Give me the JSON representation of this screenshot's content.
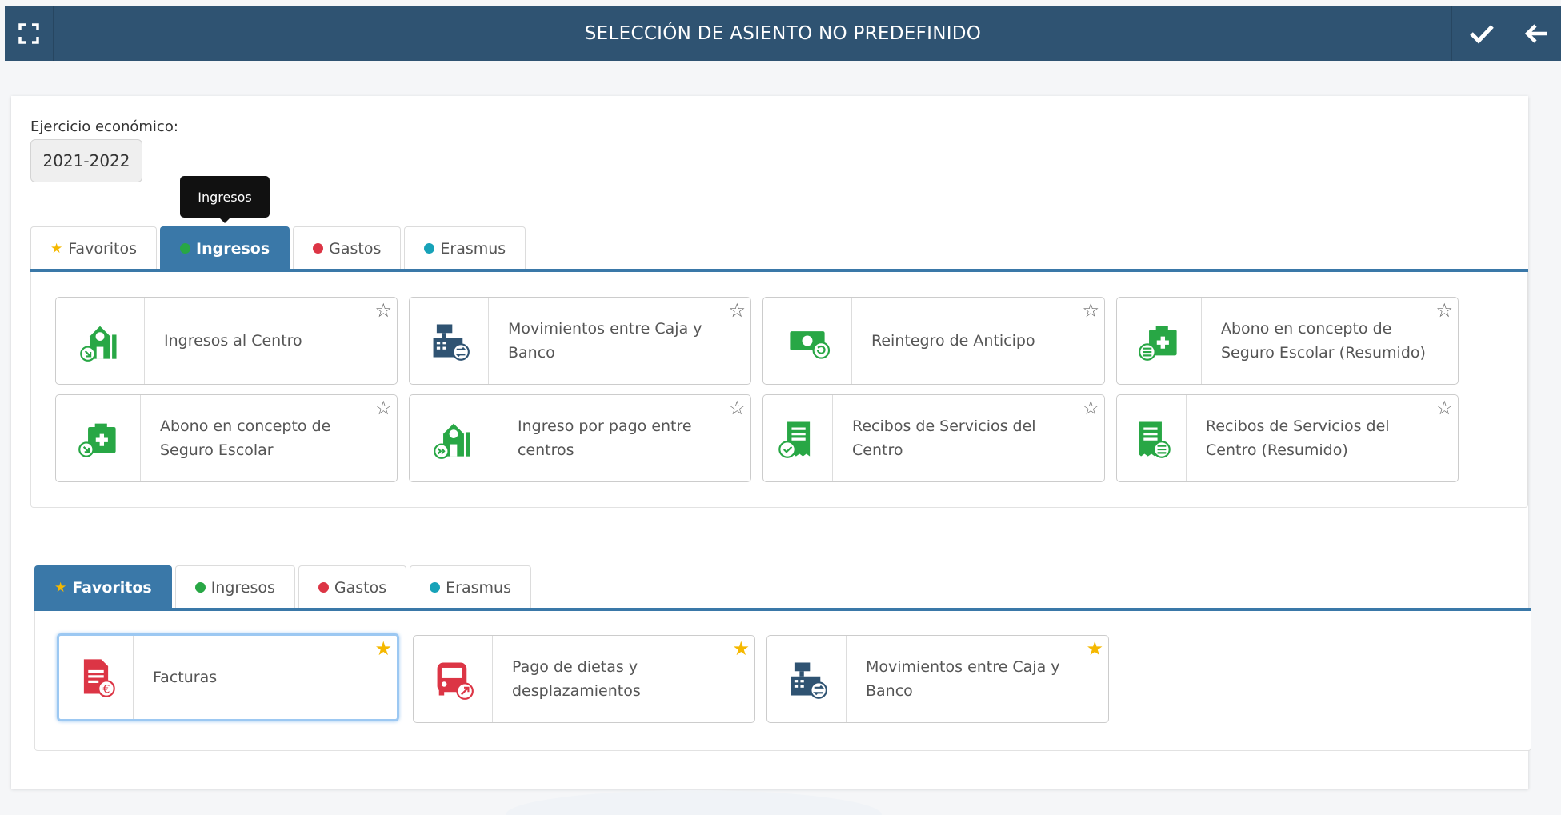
{
  "header": {
    "title": "SELECCIÓN DE ASIENTO NO PREDEFINIDO"
  },
  "ejercicio": {
    "label": "Ejercicio económico:",
    "value": "2021-2022"
  },
  "tooltip": "Ingresos",
  "top_section": {
    "tabs": [
      {
        "label": "Favoritos",
        "marker": "star",
        "color": "#f5b800",
        "active": false
      },
      {
        "label": "Ingresos",
        "marker": "dot",
        "color": "#28a745",
        "active": true
      },
      {
        "label": "Gastos",
        "marker": "dot",
        "color": "#dc3545",
        "active": false
      },
      {
        "label": "Erasmus",
        "marker": "dot",
        "color": "#17a2b8",
        "active": false
      }
    ],
    "cards": [
      {
        "label": "Ingresos al Centro",
        "icon": "building-in-icon",
        "color": "#28a745",
        "favorite": false
      },
      {
        "label": "Movimientos entre Caja y Banco",
        "icon": "cash-register-icon",
        "color": "#2f5372",
        "favorite": false
      },
      {
        "label": "Reintegro de Anticipo",
        "icon": "money-refund-icon",
        "color": "#28a745",
        "favorite": false
      },
      {
        "label": "Abono en concepto de Seguro Escolar (Resumido)",
        "icon": "medical-kit-list-icon",
        "color": "#28a745",
        "favorite": false
      },
      {
        "label": "Abono en concepto de Seguro Escolar",
        "icon": "medical-kit-in-icon",
        "color": "#28a745",
        "favorite": false
      },
      {
        "label": "Ingreso por pago entre centros",
        "icon": "building-transfer-icon",
        "color": "#28a745",
        "favorite": false
      },
      {
        "label": "Recibos de Servicios del Centro",
        "icon": "receipt-check-icon",
        "color": "#28a745",
        "favorite": false
      },
      {
        "label": "Recibos de Servicios del Centro (Resumido)",
        "icon": "receipt-list-icon",
        "color": "#28a745",
        "favorite": false
      }
    ]
  },
  "bottom_section": {
    "tabs": [
      {
        "label": "Favoritos",
        "marker": "star",
        "color": "#f5b800",
        "active": true
      },
      {
        "label": "Ingresos",
        "marker": "dot",
        "color": "#28a745",
        "active": false
      },
      {
        "label": "Gastos",
        "marker": "dot",
        "color": "#dc3545",
        "active": false
      },
      {
        "label": "Erasmus",
        "marker": "dot",
        "color": "#17a2b8",
        "active": false
      }
    ],
    "cards": [
      {
        "label": "Facturas",
        "icon": "invoice-euro-icon",
        "color": "#dc3545",
        "favorite": true
      },
      {
        "label": "Pago de dietas y desplazamientos",
        "icon": "bus-icon",
        "color": "#dc3545",
        "favorite": true
      },
      {
        "label": "Movimientos entre Caja y Banco",
        "icon": "cash-register-icon",
        "color": "#2f5372",
        "favorite": true
      }
    ]
  }
}
